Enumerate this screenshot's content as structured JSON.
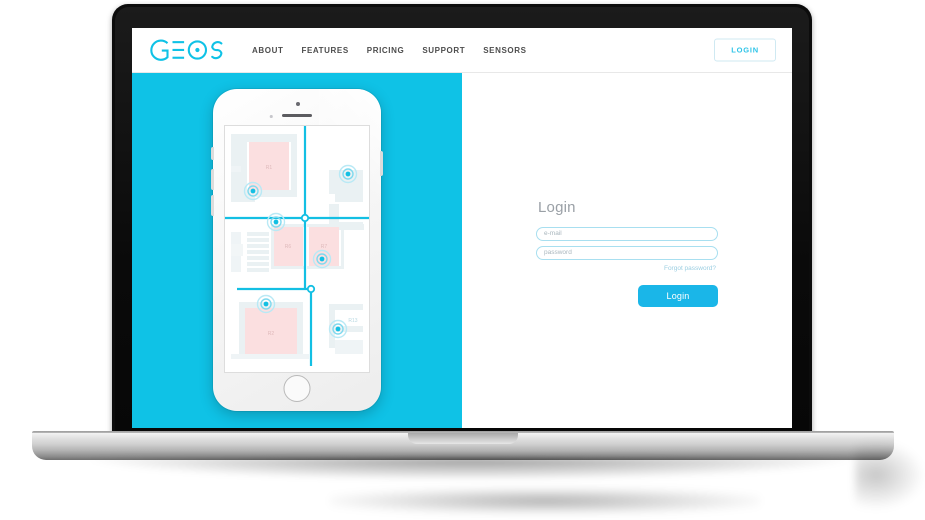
{
  "brand": {
    "logo_text": "GEOS",
    "logo_color": "#0fc2e6"
  },
  "header": {
    "nav_items": [
      {
        "label": "ABOUT"
      },
      {
        "label": "FEATURES"
      },
      {
        "label": "PRICING"
      },
      {
        "label": "SUPPORT"
      },
      {
        "label": "SENSORS"
      }
    ],
    "login_button": "LOGIN"
  },
  "hero": {
    "background_color": "#0fc2e6"
  },
  "login_form": {
    "title": "Login",
    "email_placeholder": "e-mail",
    "email_value": "",
    "password_placeholder": "password",
    "password_value": "",
    "forgot_link": "Forgot password?",
    "submit_label": "Login",
    "accent_color": "#1ab6e8",
    "field_border_color": "#a8dff0"
  },
  "phone_app": {
    "map_line_color": "#13bfe3",
    "room_fill_color": "#fbdfe0",
    "wall_color": "#e8eef0",
    "room_labels": [
      "R1",
      "R6",
      "R7",
      "R2",
      "R13"
    ],
    "sensor_count": 6
  }
}
